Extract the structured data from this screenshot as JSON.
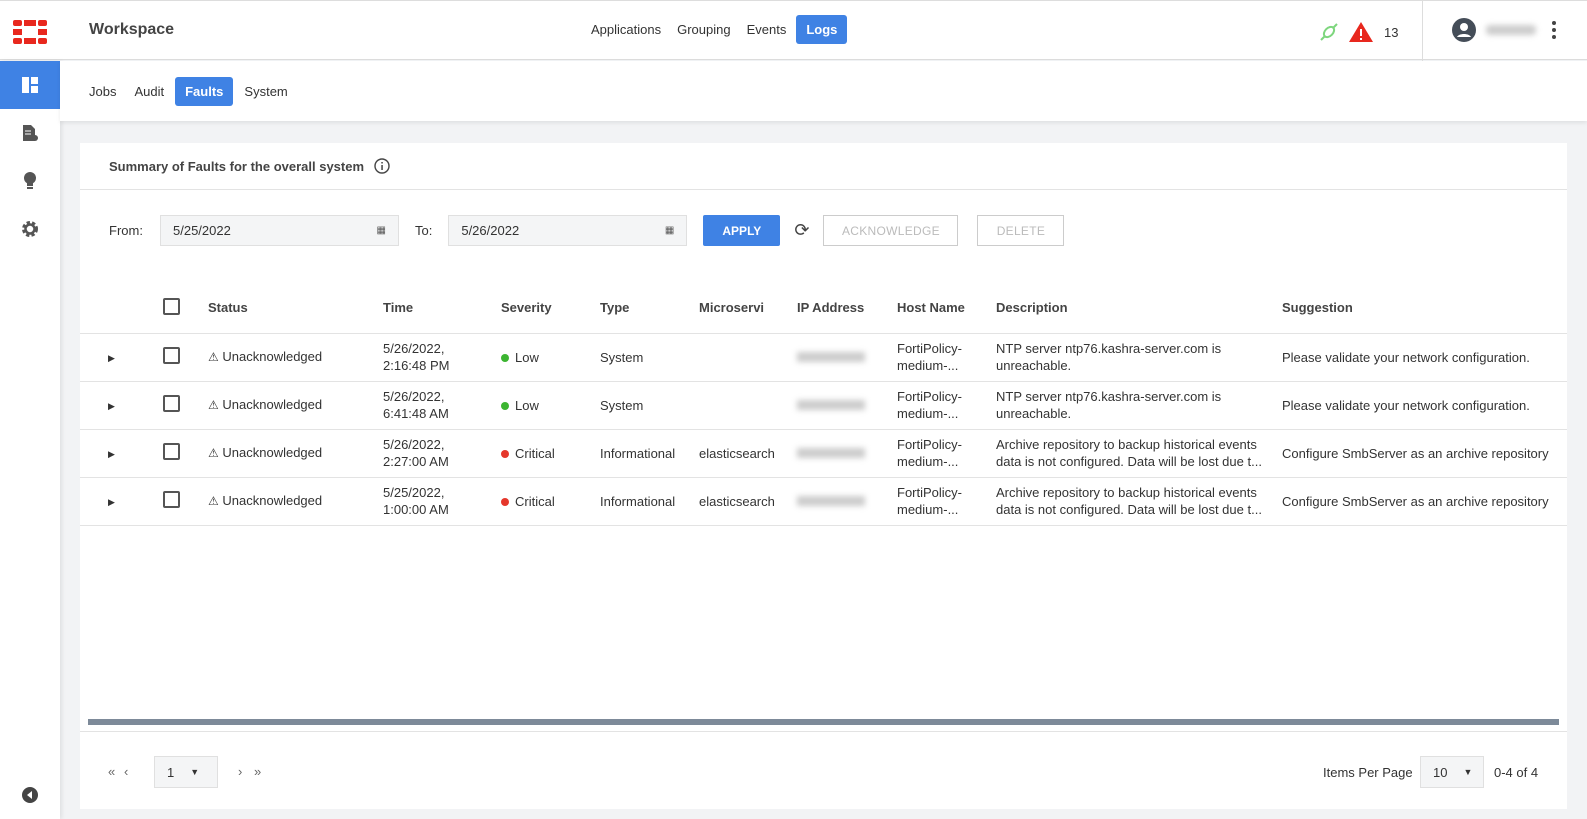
{
  "header": {
    "title": "Workspace",
    "nav": [
      "Applications",
      "Grouping",
      "Events",
      "Logs"
    ],
    "active_nav": "Logs",
    "alert_count": "13"
  },
  "subnav": {
    "tabs": [
      "Jobs",
      "Audit",
      "Faults",
      "System"
    ],
    "active": "Faults"
  },
  "card": {
    "title": "Summary of Faults for the overall system"
  },
  "filters": {
    "from_label": "From:",
    "from_value": "5/25/2022",
    "to_label": "To:",
    "to_value": "5/26/2022",
    "apply": "APPLY",
    "acknowledge": "ACKNOWLEDGE",
    "delete": "DELETE"
  },
  "table": {
    "headers": [
      "Status",
      "Time",
      "Severity",
      "Type",
      "Microservi",
      "IP Address",
      "Host Name",
      "Description",
      "Suggestion"
    ],
    "rows": [
      {
        "status": "Unacknowledged",
        "time1": "5/26/2022,",
        "time2": "2:16:48 PM",
        "severity": "Low",
        "sev_color": "#3cb531",
        "type": "System",
        "micro": "",
        "host1": "FortiPolicy-",
        "host2": "medium-...",
        "desc1": "NTP server ntp76.kashra-server.com is",
        "desc2": "unreachable.",
        "suggestion": "Please validate your network configuration."
      },
      {
        "status": "Unacknowledged",
        "time1": "5/26/2022,",
        "time2": "6:41:48 AM",
        "severity": "Low",
        "sev_color": "#3cb531",
        "type": "System",
        "micro": "",
        "host1": "FortiPolicy-",
        "host2": "medium-...",
        "desc1": "NTP server ntp76.kashra-server.com is",
        "desc2": "unreachable.",
        "suggestion": "Please validate your network configuration."
      },
      {
        "status": "Unacknowledged",
        "time1": "5/26/2022,",
        "time2": "2:27:00 AM",
        "severity": "Critical",
        "sev_color": "#e5372b",
        "type": "Informational",
        "micro": "elasticsearch",
        "host1": "FortiPolicy-",
        "host2": "medium-...",
        "desc1": "Archive repository to backup historical events",
        "desc2": "data is not configured. Data will be lost due t...",
        "suggestion": "Configure SmbServer as an archive repository"
      },
      {
        "status": "Unacknowledged",
        "time1": "5/25/2022,",
        "time2": "1:00:00 AM",
        "severity": "Critical",
        "sev_color": "#e5372b",
        "type": "Informational",
        "micro": "elasticsearch",
        "host1": "FortiPolicy-",
        "host2": "medium-...",
        "desc1": "Archive repository to backup historical events",
        "desc2": "data is not configured. Data will be lost due t...",
        "suggestion": "Configure SmbServer as an archive repository"
      }
    ]
  },
  "pager": {
    "page": "1",
    "items_label": "Items Per Page",
    "items_per_page": "10",
    "range": "0-4 of 4"
  }
}
